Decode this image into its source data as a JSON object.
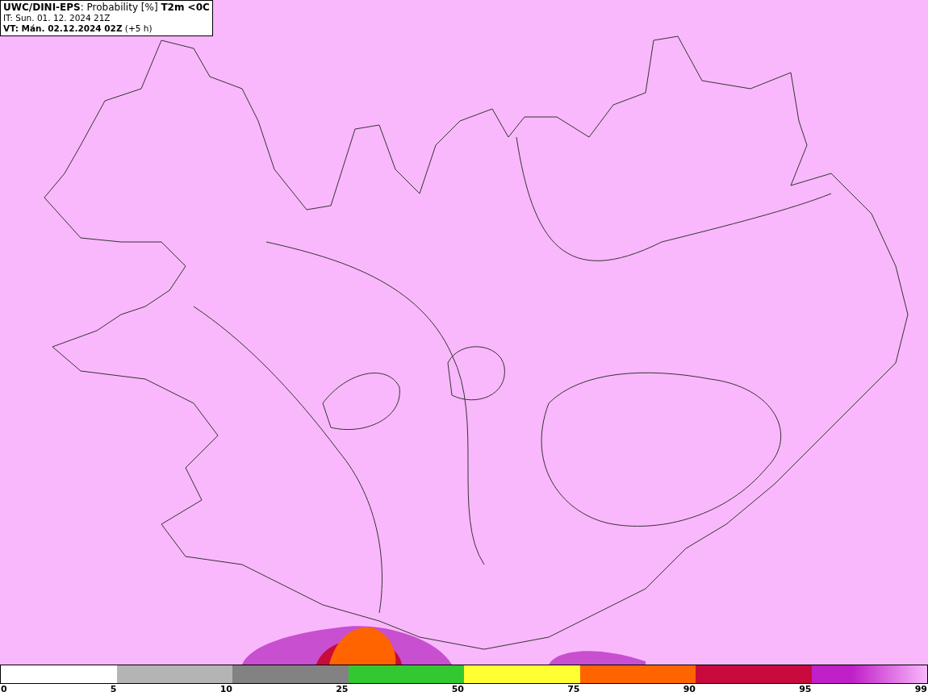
{
  "header": {
    "lines": [
      "**UWC/DINI-EPS**: Probability [%] **T2m <0C**",
      "IT: Sun. 01. 12. 2024 21Z",
      "**VT: Mán. 02.12.2024 02Z** (+5 h)"
    ]
  },
  "legend": {
    "segments": [
      {
        "color": "#ffffff"
      },
      {
        "color": "#b4b4b4"
      },
      {
        "color": "#828282"
      },
      {
        "color": "#32c832"
      },
      {
        "color": "#ffff32"
      },
      {
        "color": "#ff6400"
      },
      {
        "color": "#c80a3c"
      },
      {
        "color": "#c020c8"
      }
    ],
    "ticks": [
      "0",
      "5",
      "10",
      "25",
      "50",
      "75",
      "90",
      "95",
      "99"
    ]
  }
}
